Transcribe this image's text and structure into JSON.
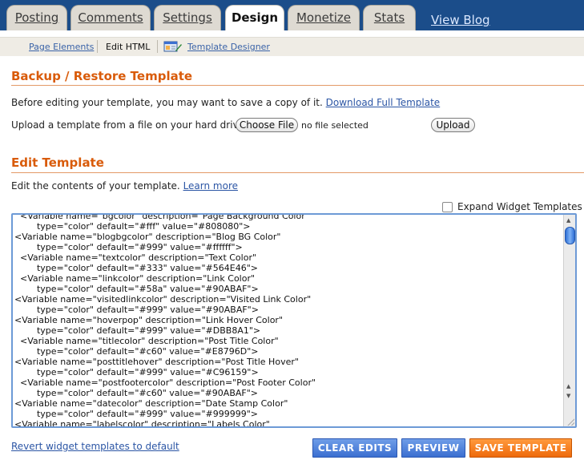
{
  "tabs": [
    {
      "label": "Posting"
    },
    {
      "label": "Comments"
    },
    {
      "label": "Settings"
    },
    {
      "label": "Design",
      "active": true
    },
    {
      "label": "Monetize"
    },
    {
      "label": "Stats"
    }
  ],
  "view_blog": "View Blog",
  "subnav": {
    "page_elements": "Page Elements",
    "edit_html": "Edit HTML",
    "template_designer": "Template Designer"
  },
  "backup": {
    "title": "Backup / Restore Template",
    "intro": "Before editing your template, you may want to save a copy of it.",
    "download_link": "Download Full Template",
    "upload_label": "Upload a template from a file on your hard drive:",
    "choose_file": "Choose File",
    "no_file": "no file selected",
    "upload_button": "Upload"
  },
  "edit": {
    "title": "Edit Template",
    "intro": "Edit the contents of your template.",
    "learn_more": "Learn more",
    "expand_widgets": "Expand Widget Templates",
    "expand_checked": false,
    "code_lines": [
      "  <Variable name=\"bgcolor\" description=\"Page Background Color\"",
      "        type=\"color\" default=\"#fff\" value=\"#808080\">",
      "<Variable name=\"blogbgcolor\" description=\"Blog BG Color\"",
      "        type=\"color\" default=\"#999\" value=\"#ffffff\">",
      "  <Variable name=\"textcolor\" description=\"Text Color\"",
      "        type=\"color\" default=\"#333\" value=\"#564E46\">",
      "  <Variable name=\"linkcolor\" description=\"Link Color\"",
      "        type=\"color\" default=\"#58a\" value=\"#90ABAF\">",
      "<Variable name=\"visitedlinkcolor\" description=\"Visited Link Color\"",
      "        type=\"color\" default=\"#999\" value=\"#90ABAF\">",
      "<Variable name=\"hoverpop\" description=\"Link Hover Color\"",
      "        type=\"color\" default=\"#999\" value=\"#DBB8A1\">",
      "  <Variable name=\"titlecolor\" description=\"Post Title Color\"",
      "        type=\"color\" default=\"#c60\" value=\"#E8796D\">",
      "<Variable name=\"posttitlehover\" description=\"Post Title Hover\"",
      "        type=\"color\" default=\"#999\" value=\"#C96159\">",
      "  <Variable name=\"postfootercolor\" description=\"Post Footer Color\"",
      "        type=\"color\" default=\"#c60\" value=\"#90ABAF\">",
      "<Variable name=\"datecolor\" description=\"Date Stamp Color\"",
      "        type=\"color\" default=\"#999\" value=\"#999999\">",
      "<Variable name=\"labelscolor\" description=\"Labels Color\""
    ]
  },
  "footer": {
    "revert_link": "Revert widget templates to default",
    "clear_edits": "CLEAR EDITS",
    "preview": "PREVIEW",
    "save_template": "SAVE TEMPLATE"
  },
  "colors": {
    "topbar": "#1b4d8a",
    "accent_orange": "#d95b0a",
    "button_blue": "#3b6fd0",
    "button_orange": "#ee6a0c"
  }
}
